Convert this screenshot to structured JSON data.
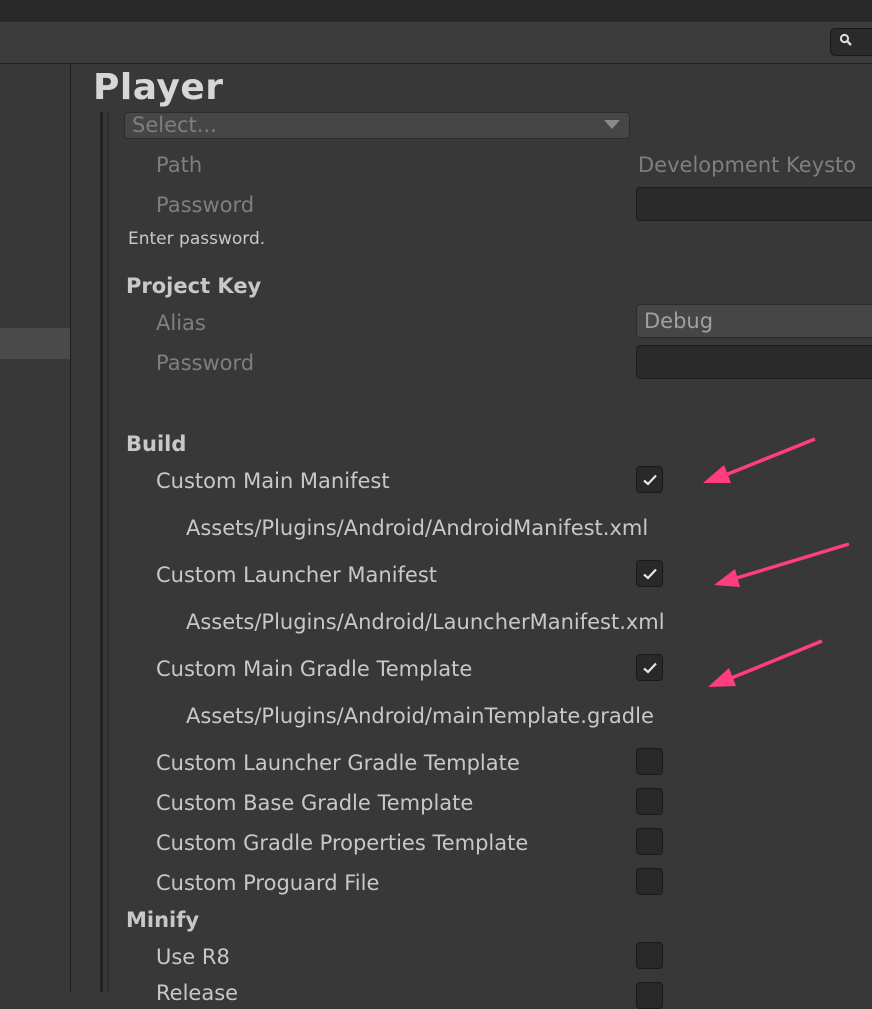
{
  "window": {
    "title": "Player"
  },
  "signing": {
    "keystore_select": "Select...",
    "path_label": "Path",
    "path_value": "Development Keysto",
    "password_label": "Password",
    "password_hint": "Enter password."
  },
  "project_key": {
    "heading": "Project Key",
    "alias_label": "Alias",
    "alias_value": "Debug",
    "password_label": "Password"
  },
  "build": {
    "heading": "Build",
    "items": [
      {
        "label": "Custom Main Manifest",
        "checked": true,
        "path": "Assets/Plugins/Android/AndroidManifest.xml"
      },
      {
        "label": "Custom Launcher Manifest",
        "checked": true,
        "path": "Assets/Plugins/Android/LauncherManifest.xml"
      },
      {
        "label": "Custom Main Gradle Template",
        "checked": true,
        "path": "Assets/Plugins/Android/mainTemplate.gradle"
      },
      {
        "label": "Custom Launcher Gradle Template",
        "checked": false
      },
      {
        "label": "Custom Base Gradle Template",
        "checked": false
      },
      {
        "label": "Custom Gradle Properties Template",
        "checked": false
      },
      {
        "label": "Custom Proguard File",
        "checked": false
      }
    ]
  },
  "minify": {
    "heading": "Minify",
    "items": [
      {
        "label": "Use R8",
        "checked": false
      },
      {
        "label": "Release",
        "checked": false
      }
    ]
  },
  "icons": {
    "search": "search-icon",
    "checkmark": "checkmark-icon",
    "dropdown": "chevron-down-icon"
  },
  "colors": {
    "annotation_arrow": "#ff3d7f",
    "background": "#383838"
  }
}
